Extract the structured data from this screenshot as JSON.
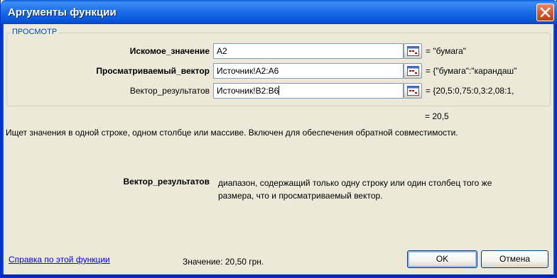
{
  "window": {
    "title": "Аргументы функции"
  },
  "group": {
    "legend": "ПРОСМОТР"
  },
  "args": [
    {
      "label": "Искомое_значение",
      "value": "A2",
      "result": "= \"бумага\"",
      "bold": true
    },
    {
      "label": "Просматриваемый_вектор",
      "value": "Источник!A2:A6",
      "result": "= {\"бумага\":\"карандаш\"",
      "bold": true
    },
    {
      "label": "Вектор_результатов",
      "value": "Источник!B2:B6",
      "result": "= {20,5:0,75:0,3:2,08:1,",
      "bold": false
    }
  ],
  "formula_result": "=  20,5",
  "description": "Ищет значения в одной строке, одном столбце или массиве. Включен для обеспечения обратной совместимости.",
  "param": {
    "name": "Вектор_результатов",
    "description": "диапазон, содержащий только одну строку или один столбец того же размера, что и просматриваемый вектор."
  },
  "footer": {
    "help_link": "Справка по этой функции",
    "value_label": "Значение: 20,50 грн.",
    "ok_label": "OK",
    "cancel_label": "Отмена"
  },
  "icons": {
    "close": "close-icon",
    "collapse": "collapse-dialog-icon"
  },
  "colors": {
    "title_bar": "#0a58dd",
    "legend": "#0046d5",
    "link": "#0000ff",
    "close_button": "#d85a36"
  }
}
